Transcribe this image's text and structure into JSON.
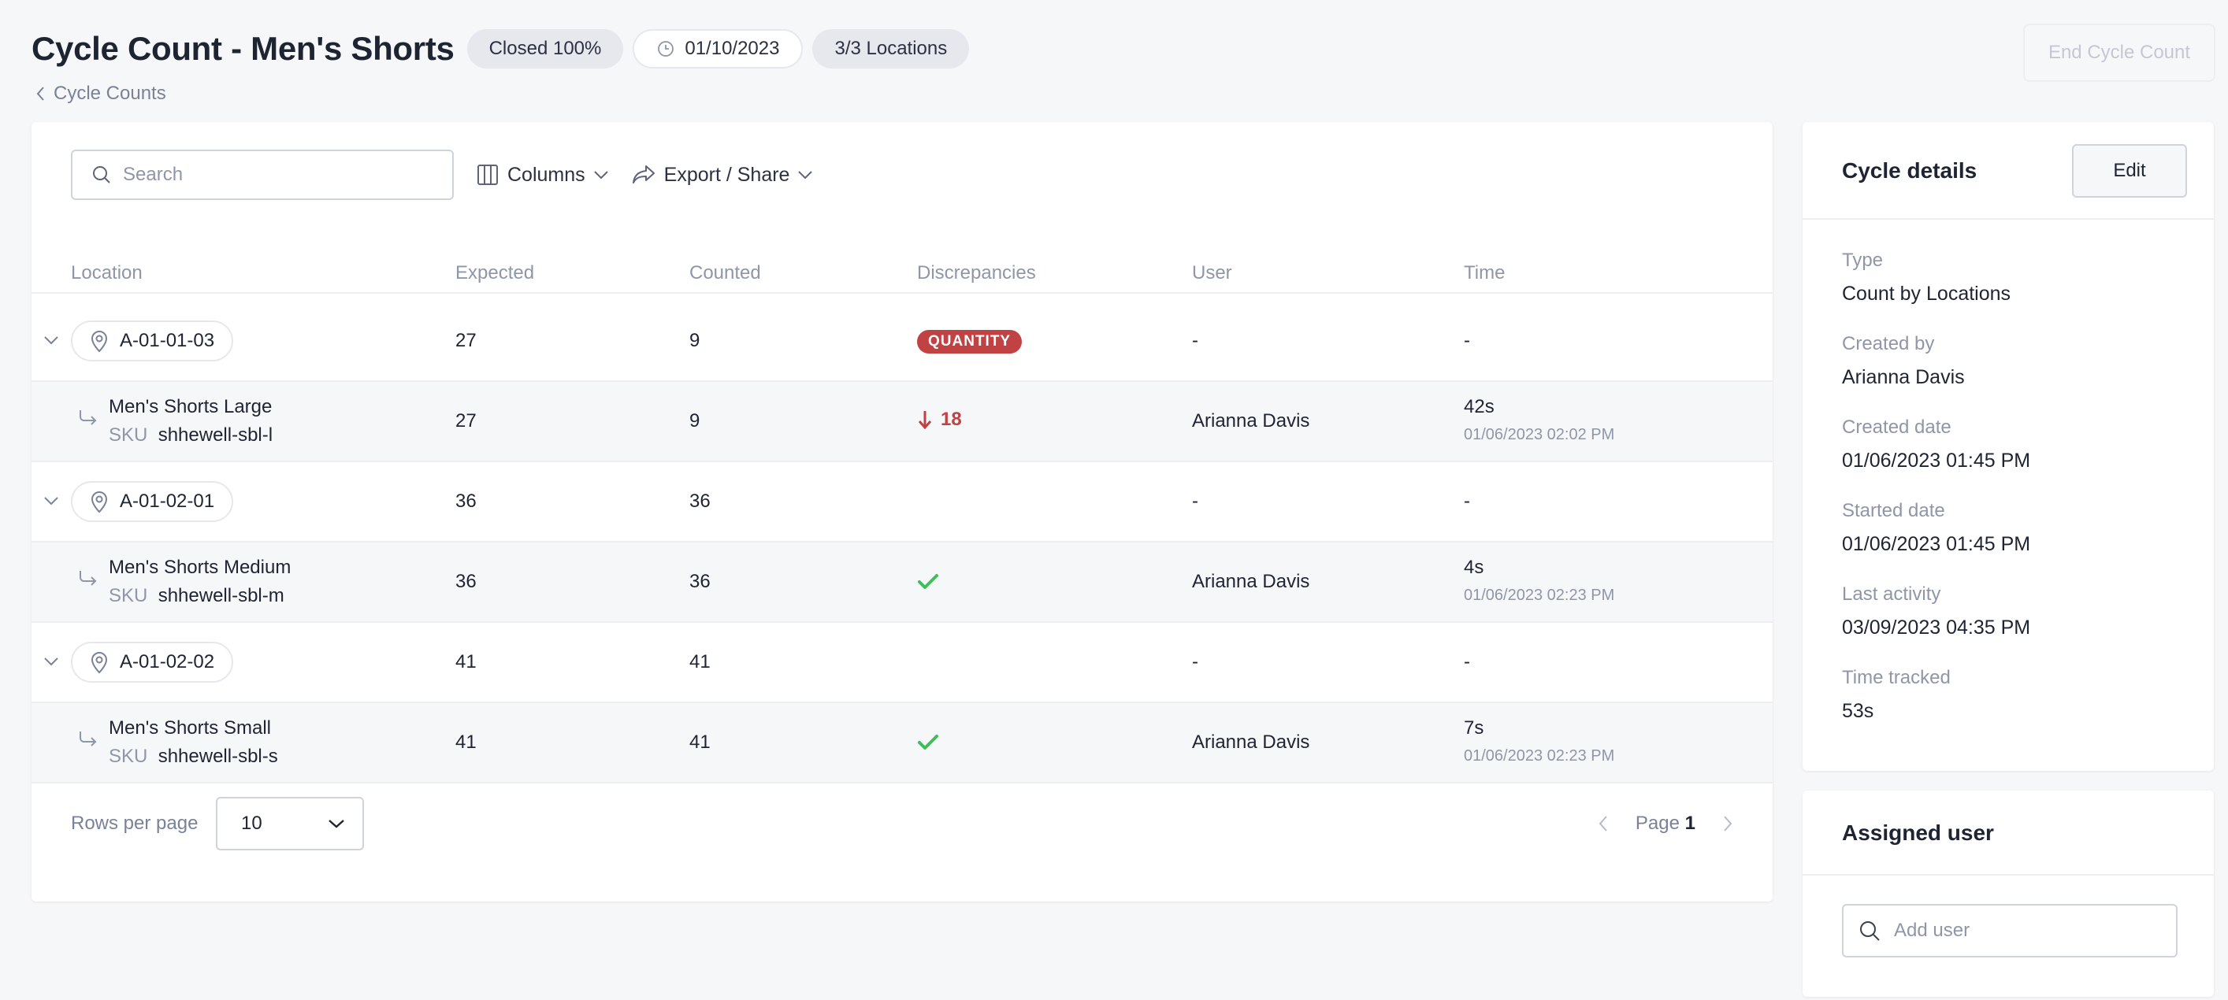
{
  "header": {
    "title": "Cycle Count - Men's Shorts",
    "status": "Closed 100%",
    "date": "01/10/2023",
    "locations": "3/3 Locations",
    "end_button": "End Cycle Count",
    "breadcrumb": "Cycle Counts"
  },
  "toolbar": {
    "search_placeholder": "Search",
    "columns_label": "Columns",
    "export_label": "Export / Share"
  },
  "table": {
    "columns": [
      "Location",
      "Expected",
      "Counted",
      "Discrepancies",
      "User",
      "Time"
    ],
    "groups": [
      {
        "location": "A-01-01-03",
        "expected": "27",
        "counted": "9",
        "discrepancy_badge": "QUANTITY",
        "user": "-",
        "time": "-",
        "item": {
          "name": "Men's Shorts Large",
          "sku_label": "SKU",
          "sku": "shhewell-sbl-l",
          "expected": "27",
          "counted": "9",
          "discrepancy": "18",
          "user": "Arianna Davis",
          "time": "42s",
          "timestamp": "01/06/2023 02:02 PM"
        }
      },
      {
        "location": "A-01-02-01",
        "expected": "36",
        "counted": "36",
        "user": "-",
        "time": "-",
        "item": {
          "name": "Men's Shorts Medium",
          "sku_label": "SKU",
          "sku": "shhewell-sbl-m",
          "expected": "36",
          "counted": "36",
          "user": "Arianna Davis",
          "time": "4s",
          "timestamp": "01/06/2023 02:23 PM"
        }
      },
      {
        "location": "A-01-02-02",
        "expected": "41",
        "counted": "41",
        "user": "-",
        "time": "-",
        "item": {
          "name": "Men's Shorts Small",
          "sku_label": "SKU",
          "sku": "shhewell-sbl-s",
          "expected": "41",
          "counted": "41",
          "user": "Arianna Davis",
          "time": "7s",
          "timestamp": "01/06/2023 02:23 PM"
        }
      }
    ]
  },
  "footer": {
    "rows_per_page_label": "Rows per page",
    "rows_per_page_value": "10",
    "page_label": "Page",
    "page_number": "1"
  },
  "details": {
    "title": "Cycle details",
    "edit_label": "Edit",
    "fields": [
      {
        "label": "Type",
        "value": "Count by Locations"
      },
      {
        "label": "Created by",
        "value": "Arianna Davis"
      },
      {
        "label": "Created date",
        "value": "01/06/2023 01:45 PM"
      },
      {
        "label": "Started date",
        "value": "01/06/2023 01:45 PM"
      },
      {
        "label": "Last activity",
        "value": "03/09/2023 04:35 PM"
      },
      {
        "label": "Time tracked",
        "value": "53s"
      }
    ]
  },
  "assigned": {
    "title": "Assigned user",
    "placeholder": "Add user"
  },
  "colors": {
    "danger": "#c04242",
    "success": "#3fbf5a",
    "muted": "#8f96a8",
    "text": "#1f2433",
    "background": "#f6f7f9"
  },
  "icons": [
    "clock-icon",
    "chevron-left-icon",
    "search-icon",
    "columns-icon",
    "chevron-down-icon",
    "share-icon",
    "map-pin-icon",
    "child-arrow-icon",
    "arrow-down-icon",
    "check-icon",
    "chevron-right-icon"
  ]
}
